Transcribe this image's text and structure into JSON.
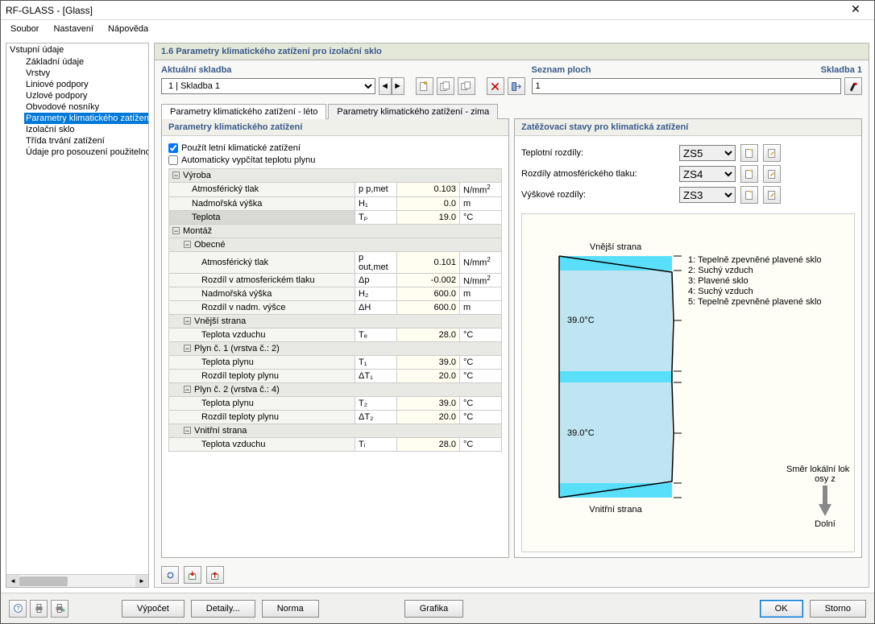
{
  "window": {
    "title": "RF-GLASS - [Glass]"
  },
  "menu": {
    "file": "Soubor",
    "settings": "Nastavení",
    "help": "Nápověda"
  },
  "sidebar": {
    "root": "Vstupní údaje",
    "items": [
      "Základní údaje",
      "Vrstvy",
      "Liniové podpory",
      "Uzlové podpory",
      "Obvodové nosníky",
      "Parametry klimatického zatížení",
      "Izolační sklo",
      "Třída trvání zatížení",
      "Údaje pro posouzení použitelnosti"
    ],
    "selected_index": 5
  },
  "header": "1.6 Parametry klimatického zatížení pro izolační sklo",
  "top": {
    "left_label": "Aktuální skladba",
    "combo_value": "1 | Skladba 1",
    "right_label": "Seznam ploch",
    "right_sub": "Skladba 1",
    "list_value": "1"
  },
  "tabs": {
    "summer": "Parametry klimatického zatížení - léto",
    "winter": "Parametry klimatického zatížení - zima"
  },
  "left_pane": {
    "title": "Parametry klimatického zatížení",
    "cb_use": "Použít letní klimatické zatížení",
    "cb_auto": "Automaticky vypčítat teplotu plynu",
    "groups": {
      "vyroba": "Výroba",
      "montaz": "Montáž",
      "obecne": "Obecné",
      "vnejsi": "Vnější strana",
      "plyn1": "Plyn č. 1 (vrstva č.: 2)",
      "plyn2": "Plyn č. 2 (vrstva č.: 4)",
      "vnitrni": "Vnitřní strana"
    },
    "rows": {
      "atm_tlak_v": {
        "label": "Atmosférický tlak",
        "sym": "p p,met",
        "val": "0.103",
        "unit": "N/mm²"
      },
      "nadm_v": {
        "label": "Nadmořská výška",
        "sym": "H₁",
        "val": "0.0",
        "unit": "m"
      },
      "teplota_v": {
        "label": "Teplota",
        "sym": "Tₚ",
        "val": "19.0",
        "unit": "°C"
      },
      "atm_tlak_m": {
        "label": "Atmosférický tlak",
        "sym": "p out,met",
        "val": "0.101",
        "unit": "N/mm²"
      },
      "rozdil_atm": {
        "label": "Rozdíl v atmosferickém tlaku",
        "sym": "Δp",
        "val": "-0.002",
        "unit": "N/mm²"
      },
      "nadm_m": {
        "label": "Nadmořská výška",
        "sym": "H₂",
        "val": "600.0",
        "unit": "m"
      },
      "rozdil_nadm": {
        "label": "Rozdíl v nadm. výšce",
        "sym": "ΔH",
        "val": "600.0",
        "unit": "m"
      },
      "te": {
        "label": "Teplota vzduchu",
        "sym": "Tₑ",
        "val": "28.0",
        "unit": "°C"
      },
      "t1": {
        "label": "Teplota plynu",
        "sym": "T₁",
        "val": "39.0",
        "unit": "°C"
      },
      "dt1": {
        "label": "Rozdíl teploty plynu",
        "sym": "ΔT₁",
        "val": "20.0",
        "unit": "°C"
      },
      "t2": {
        "label": "Teplota plynu",
        "sym": "T₂",
        "val": "39.0",
        "unit": "°C"
      },
      "dt2": {
        "label": "Rozdíl teploty plynu",
        "sym": "ΔT₂",
        "val": "20.0",
        "unit": "°C"
      },
      "ti": {
        "label": "Teplota vzduchu",
        "sym": "Tᵢ",
        "val": "28.0",
        "unit": "°C"
      }
    }
  },
  "right_pane": {
    "title": "Zatěžovací stavy pro klimatická zatížení",
    "rows": [
      {
        "label": "Teplotní rozdíly:",
        "value": "ZS5"
      },
      {
        "label": "Rozdíly atmosférického tlaku:",
        "value": "ZS4"
      },
      {
        "label": "Výškové rozdíly:",
        "value": "ZS3"
      }
    ],
    "diagram": {
      "top_label": "Vnější strana",
      "bottom_label": "Vnitřní strana",
      "temp": "39.0°C",
      "legend": [
        "1: Tepelně zpevněné plavené sklo",
        "2: Suchý vzduch",
        "3: Plavené sklo",
        "4: Suchý vzduch",
        "5: Tepelně zpevněné plavené sklo"
      ],
      "axis_caption": "Směr lokální osy z",
      "axis_end": "Dolní"
    }
  },
  "footer": {
    "vypocet": "Výpočet",
    "detaily": "Detaily...",
    "norma": "Norma",
    "grafika": "Grafika",
    "ok": "OK",
    "storno": "Storno"
  }
}
